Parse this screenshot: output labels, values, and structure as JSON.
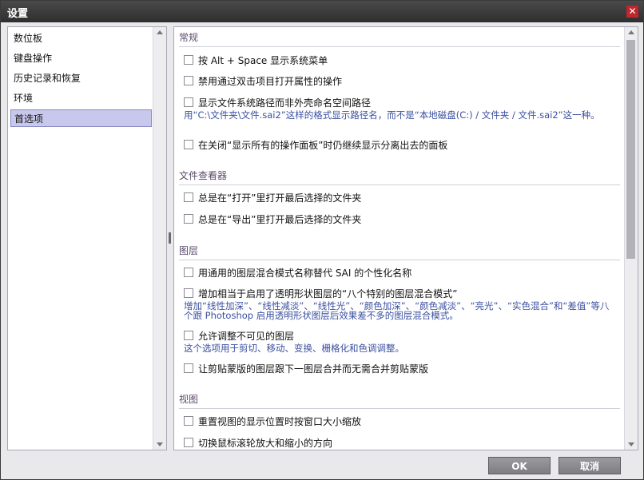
{
  "window": {
    "title": "设置"
  },
  "nav": {
    "items": [
      {
        "label": "数位板"
      },
      {
        "label": "键盘操作"
      },
      {
        "label": "历史记录和恢复"
      },
      {
        "label": "环境"
      },
      {
        "label": "首选项"
      }
    ],
    "selected": "首选项"
  },
  "sections": {
    "general": {
      "title": "常规",
      "opt1": "按 Alt + Space 显示系统菜单",
      "opt2": "禁用通过双击项目打开属性的操作",
      "opt3": "显示文件系统路径而非外壳命名空间路径",
      "opt3_desc": "用“C:\\文件夹\\文件.sai2”这样的格式显示路径名，而不是“本地磁盘(C:) / 文件夹 / 文件.sai2”这一种。",
      "opt4": "在关闭“显示所有的操作面板”时仍继续显示分离出去的面板"
    },
    "viewer": {
      "title": "文件查看器",
      "opt1": "总是在“打开”里打开最后选择的文件夹",
      "opt2": "总是在“导出”里打开最后选择的文件夹"
    },
    "layers": {
      "title": "图层",
      "opt1": "用通用的图层混合模式名称替代 SAI 的个性化名称",
      "opt2": "增加相当于启用了透明形状图层的“八个特别的图层混合模式”",
      "opt2_desc": "增加“线性加深”、“线性减淡”、“线性光”、“颜色加深”、“颜色减淡”、“亮光”、“实色混合”和“差值”等八个跟 Photoshop 启用透明形状图层后效果差不多的图层混合模式。",
      "opt3": "允许调整不可见的图层",
      "opt3_desc": "这个选项用于剪切、移动、变换、栅格化和色调调整。",
      "opt4": "让剪贴蒙版的图层跟下一图层合并而无需合并剪贴蒙版"
    },
    "view": {
      "title": "视图",
      "opt1": "重置视图的显示位置时按窗口大小缩放",
      "opt2": "切换鼠标滚轮放大和缩小的方向"
    }
  },
  "buttons": {
    "ok": "OK",
    "cancel": "取消"
  },
  "colors": {
    "selected_bg": "#c8c8ec",
    "title_bg": "#2e2e2e",
    "desc_text": "#3a4fa0"
  }
}
